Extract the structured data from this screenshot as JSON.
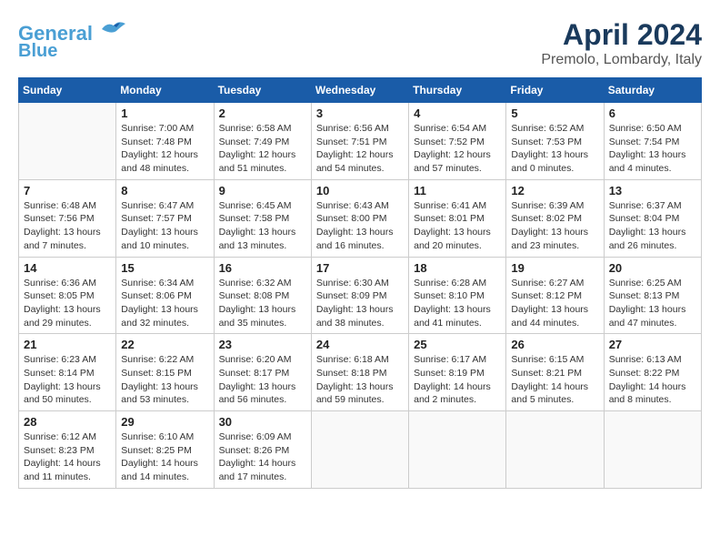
{
  "header": {
    "logo_line1": "General",
    "logo_line2": "Blue",
    "month_title": "April 2024",
    "location": "Premolo, Lombardy, Italy"
  },
  "weekdays": [
    "Sunday",
    "Monday",
    "Tuesday",
    "Wednesday",
    "Thursday",
    "Friday",
    "Saturday"
  ],
  "weeks": [
    [
      {
        "day": "",
        "info": ""
      },
      {
        "day": "1",
        "info": "Sunrise: 7:00 AM\nSunset: 7:48 PM\nDaylight: 12 hours\nand 48 minutes."
      },
      {
        "day": "2",
        "info": "Sunrise: 6:58 AM\nSunset: 7:49 PM\nDaylight: 12 hours\nand 51 minutes."
      },
      {
        "day": "3",
        "info": "Sunrise: 6:56 AM\nSunset: 7:51 PM\nDaylight: 12 hours\nand 54 minutes."
      },
      {
        "day": "4",
        "info": "Sunrise: 6:54 AM\nSunset: 7:52 PM\nDaylight: 12 hours\nand 57 minutes."
      },
      {
        "day": "5",
        "info": "Sunrise: 6:52 AM\nSunset: 7:53 PM\nDaylight: 13 hours\nand 0 minutes."
      },
      {
        "day": "6",
        "info": "Sunrise: 6:50 AM\nSunset: 7:54 PM\nDaylight: 13 hours\nand 4 minutes."
      }
    ],
    [
      {
        "day": "7",
        "info": "Sunrise: 6:48 AM\nSunset: 7:56 PM\nDaylight: 13 hours\nand 7 minutes."
      },
      {
        "day": "8",
        "info": "Sunrise: 6:47 AM\nSunset: 7:57 PM\nDaylight: 13 hours\nand 10 minutes."
      },
      {
        "day": "9",
        "info": "Sunrise: 6:45 AM\nSunset: 7:58 PM\nDaylight: 13 hours\nand 13 minutes."
      },
      {
        "day": "10",
        "info": "Sunrise: 6:43 AM\nSunset: 8:00 PM\nDaylight: 13 hours\nand 16 minutes."
      },
      {
        "day": "11",
        "info": "Sunrise: 6:41 AM\nSunset: 8:01 PM\nDaylight: 13 hours\nand 20 minutes."
      },
      {
        "day": "12",
        "info": "Sunrise: 6:39 AM\nSunset: 8:02 PM\nDaylight: 13 hours\nand 23 minutes."
      },
      {
        "day": "13",
        "info": "Sunrise: 6:37 AM\nSunset: 8:04 PM\nDaylight: 13 hours\nand 26 minutes."
      }
    ],
    [
      {
        "day": "14",
        "info": "Sunrise: 6:36 AM\nSunset: 8:05 PM\nDaylight: 13 hours\nand 29 minutes."
      },
      {
        "day": "15",
        "info": "Sunrise: 6:34 AM\nSunset: 8:06 PM\nDaylight: 13 hours\nand 32 minutes."
      },
      {
        "day": "16",
        "info": "Sunrise: 6:32 AM\nSunset: 8:08 PM\nDaylight: 13 hours\nand 35 minutes."
      },
      {
        "day": "17",
        "info": "Sunrise: 6:30 AM\nSunset: 8:09 PM\nDaylight: 13 hours\nand 38 minutes."
      },
      {
        "day": "18",
        "info": "Sunrise: 6:28 AM\nSunset: 8:10 PM\nDaylight: 13 hours\nand 41 minutes."
      },
      {
        "day": "19",
        "info": "Sunrise: 6:27 AM\nSunset: 8:12 PM\nDaylight: 13 hours\nand 44 minutes."
      },
      {
        "day": "20",
        "info": "Sunrise: 6:25 AM\nSunset: 8:13 PM\nDaylight: 13 hours\nand 47 minutes."
      }
    ],
    [
      {
        "day": "21",
        "info": "Sunrise: 6:23 AM\nSunset: 8:14 PM\nDaylight: 13 hours\nand 50 minutes."
      },
      {
        "day": "22",
        "info": "Sunrise: 6:22 AM\nSunset: 8:15 PM\nDaylight: 13 hours\nand 53 minutes."
      },
      {
        "day": "23",
        "info": "Sunrise: 6:20 AM\nSunset: 8:17 PM\nDaylight: 13 hours\nand 56 minutes."
      },
      {
        "day": "24",
        "info": "Sunrise: 6:18 AM\nSunset: 8:18 PM\nDaylight: 13 hours\nand 59 minutes."
      },
      {
        "day": "25",
        "info": "Sunrise: 6:17 AM\nSunset: 8:19 PM\nDaylight: 14 hours\nand 2 minutes."
      },
      {
        "day": "26",
        "info": "Sunrise: 6:15 AM\nSunset: 8:21 PM\nDaylight: 14 hours\nand 5 minutes."
      },
      {
        "day": "27",
        "info": "Sunrise: 6:13 AM\nSunset: 8:22 PM\nDaylight: 14 hours\nand 8 minutes."
      }
    ],
    [
      {
        "day": "28",
        "info": "Sunrise: 6:12 AM\nSunset: 8:23 PM\nDaylight: 14 hours\nand 11 minutes."
      },
      {
        "day": "29",
        "info": "Sunrise: 6:10 AM\nSunset: 8:25 PM\nDaylight: 14 hours\nand 14 minutes."
      },
      {
        "day": "30",
        "info": "Sunrise: 6:09 AM\nSunset: 8:26 PM\nDaylight: 14 hours\nand 17 minutes."
      },
      {
        "day": "",
        "info": ""
      },
      {
        "day": "",
        "info": ""
      },
      {
        "day": "",
        "info": ""
      },
      {
        "day": "",
        "info": ""
      }
    ]
  ]
}
